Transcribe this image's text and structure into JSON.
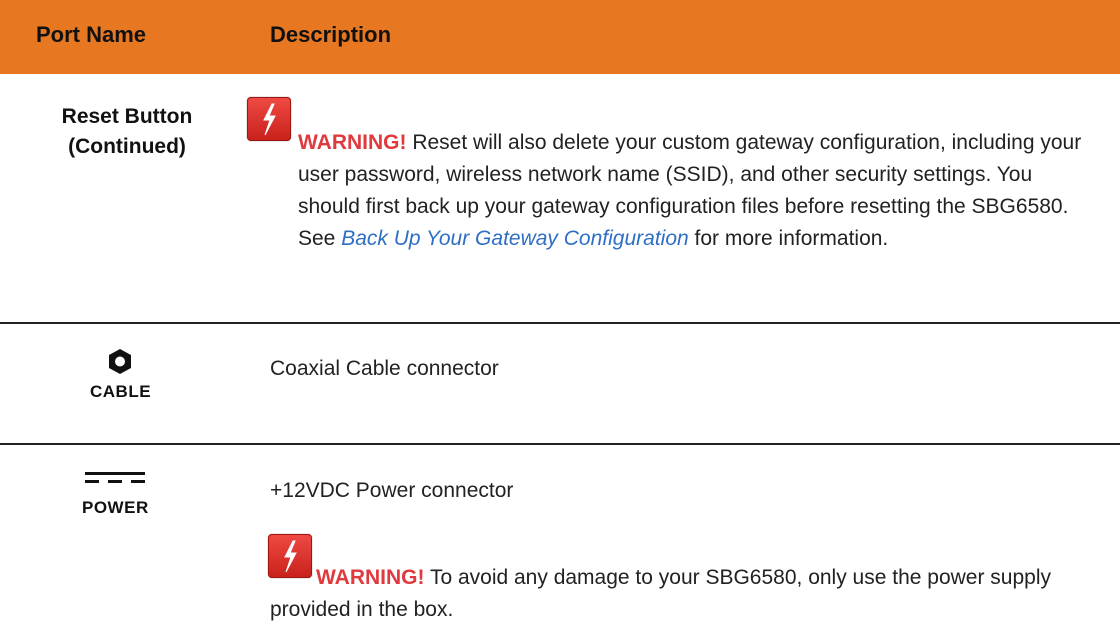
{
  "header": {
    "col1": "Port Name",
    "col2": "Description",
    "bg_color": "#e87722"
  },
  "rows": [
    {
      "port_name_line1": "Reset Button",
      "port_name_line2": "(Continued)",
      "warning_icon": "lightning-warning-icon",
      "warning_label": "WARNING!",
      "warning_text_1": " Reset will also delete your custom gateway configuration, including your user password, wireless network name (SSID), and other security settings. You should first back up your gateway configuration files before resetting the SBG6580. See ",
      "link_text": "Back Up Your Gateway Configuration",
      "warning_text_2": " for more information."
    },
    {
      "icon": "coaxial-cable-icon",
      "icon_label": "CABLE",
      "description": "Coaxial Cable connector"
    },
    {
      "icon": "dc-power-icon",
      "icon_label": "POWER",
      "description": "+12VDC Power connector",
      "warning_icon": "lightning-warning-icon",
      "warning_label": "WARNING!",
      "warning_text": " To avoid any damage to your SBG6580, only use the power supply provided in the box."
    }
  ],
  "colors": {
    "warning": "#e0393e",
    "link": "#2e6fc4"
  }
}
